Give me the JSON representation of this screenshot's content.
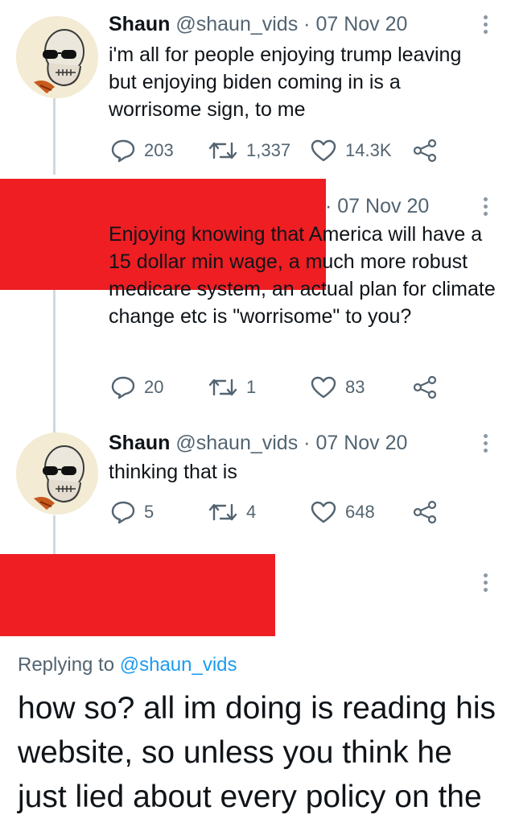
{
  "tweets": [
    {
      "name": "Shaun",
      "handle": "@shaun_vids",
      "sep": " · ",
      "date": "07 Nov 20",
      "text": "i'm all for people enjoying trump leaving but enjoying biden coming in is a worrisome sign, to me",
      "replies": "203",
      "retweets": "1,337",
      "likes": "14.3K"
    },
    {
      "sep": "· ",
      "date": "07 Nov 20",
      "text": "Enjoying knowing that America will have a 15 dollar min wage, a much more robust medicare system, an actual plan for climate change etc is \"worrisome\" to you?",
      "replies": "20",
      "retweets": "1",
      "likes": "83"
    },
    {
      "name": "Shaun",
      "handle": "@shaun_vids",
      "sep": " · ",
      "date": "07 Nov 20",
      "text": "thinking that is",
      "replies": "5",
      "retweets": "4",
      "likes": "648"
    }
  ],
  "focused": {
    "replying_prefix": "Replying to ",
    "replying_handle": "@shaun_vids",
    "text": "how so?  all im doing is reading his website, so unless you think he just lied about every policy on the"
  },
  "colors": {
    "redaction": "#ee1e23",
    "link": "#1d9bf0",
    "muted": "#536471",
    "thread_line": "#cfd9de"
  }
}
